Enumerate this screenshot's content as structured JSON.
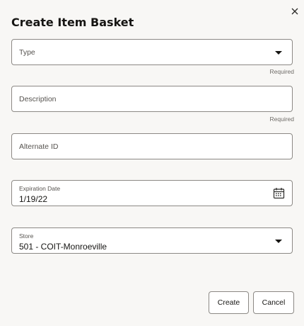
{
  "dialog": {
    "title": "Create Item Basket",
    "close_icon": "close-icon"
  },
  "fields": {
    "type": {
      "placeholder": "Type",
      "helper": "Required"
    },
    "description": {
      "placeholder": "Description",
      "helper": "Required"
    },
    "alternate_id": {
      "placeholder": "Alternate ID"
    },
    "expiration_date": {
      "label": "Expiration Date",
      "value": "1/19/22",
      "icon": "calendar-icon"
    },
    "store": {
      "label": "Store",
      "value": "501 - COIT-Monroeville"
    }
  },
  "buttons": {
    "create": "Create",
    "cancel": "Cancel"
  }
}
